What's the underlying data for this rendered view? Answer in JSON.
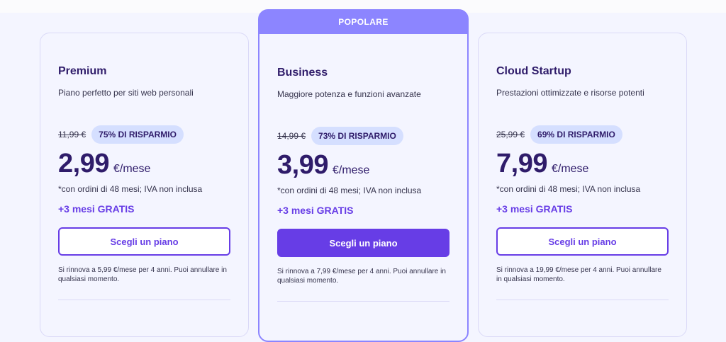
{
  "colors": {
    "primary": "#673de6",
    "heading": "#2f1c6a",
    "popular_banner": "#8c85ff",
    "badge_bg": "#d5dfff",
    "card_border": "#dad9f7",
    "background": "#f4f5ff"
  },
  "plans": [
    {
      "name": "Premium",
      "description": "Piano perfetto per siti web personali",
      "old_price": "11,99 €",
      "discount": "75% DI RISPARMIO",
      "price": "2,99",
      "unit": "€/mese",
      "note": "*con ordini di 48 mesi; IVA non inclusa",
      "bonus": "+3 mesi GRATIS",
      "button": "Scegli un piano",
      "renewal": "Si rinnova a 5,99 €/mese per 4 anni. Puoi annullare in qualsiasi momento."
    },
    {
      "badge": "POPOLARE",
      "name": "Business",
      "description": "Maggiore potenza e funzioni avanzate",
      "old_price": "14,99 €",
      "discount": "73% DI RISPARMIO",
      "price": "3,99",
      "unit": "€/mese",
      "note": "*con ordini di 48 mesi; IVA non inclusa",
      "bonus": "+3 mesi GRATIS",
      "button": "Scegli un piano",
      "renewal": "Si rinnova a 7,99 €/mese per 4 anni. Puoi annullare in qualsiasi momento."
    },
    {
      "name": "Cloud Startup",
      "description": "Prestazioni ottimizzate e risorse potenti",
      "old_price": "25,99 €",
      "discount": "69% DI RISPARMIO",
      "price": "7,99",
      "unit": "€/mese",
      "note": "*con ordini di 48 mesi; IVA non inclusa",
      "bonus": "+3 mesi GRATIS",
      "button": "Scegli un piano",
      "renewal": "Si rinnova a 19,99 €/mese per 4 anni. Puoi annullare in qualsiasi momento."
    }
  ]
}
